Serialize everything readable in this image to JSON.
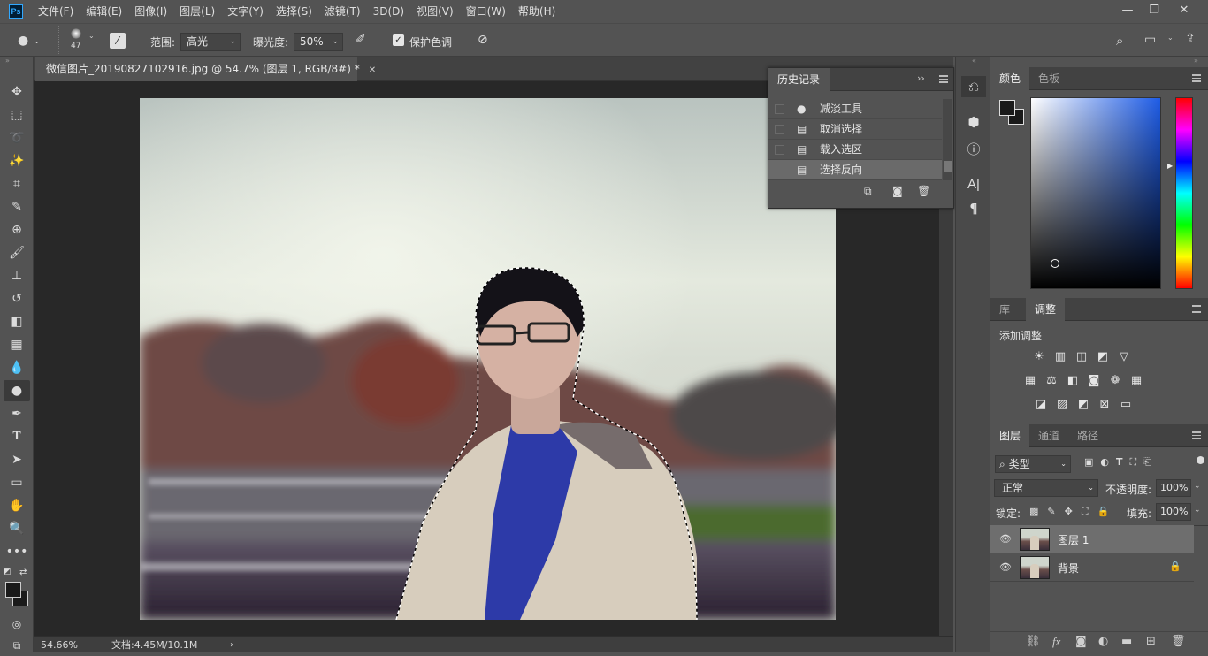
{
  "app": {
    "logo": "Ps"
  },
  "menubar": {
    "items": [
      "文件(F)",
      "编辑(E)",
      "图像(I)",
      "图层(L)",
      "文字(Y)",
      "选择(S)",
      "滤镜(T)",
      "3D(D)",
      "视图(V)",
      "窗口(W)",
      "帮助(H)"
    ]
  },
  "options": {
    "brush_size": "47",
    "range_label": "范围:",
    "range_value": "高光",
    "exposure_label": "曝光度:",
    "exposure_value": "50%",
    "protect_tones_label": "保护色调",
    "protect_tones_checked": true
  },
  "document": {
    "tab_title": "微信图片_20190827102916.jpg @ 54.7% (图层 1, RGB/8#) *",
    "zoom": "54.66%",
    "doc_info": "文档:4.45M/10.1M"
  },
  "history": {
    "title": "历史记录",
    "items": [
      {
        "label": "减淡工具",
        "icon": "dodge-icon"
      },
      {
        "label": "取消选择",
        "icon": "document-icon"
      },
      {
        "label": "载入选区",
        "icon": "document-icon"
      },
      {
        "label": "选择反向",
        "icon": "document-icon"
      }
    ],
    "selected_index": 3
  },
  "color_panel": {
    "tabs": [
      "颜色",
      "色板"
    ],
    "foreground": "#1a1a1a",
    "background": "#1a1a1a",
    "hue_color": "#1e5ce6"
  },
  "adjust_panel": {
    "tabs": [
      "库",
      "调整"
    ],
    "title": "添加调整"
  },
  "layers_panel": {
    "tabs": [
      "图层",
      "通道",
      "路径"
    ],
    "filter_label": "类型",
    "blend_mode": "正常",
    "opacity_label": "不透明度:",
    "opacity_value": "100%",
    "lock_label": "锁定:",
    "fill_label": "填充:",
    "fill_value": "100%",
    "layers": [
      {
        "name": "图层 1",
        "selected": true,
        "locked": false
      },
      {
        "name": "背景",
        "selected": false,
        "locked": true
      }
    ]
  }
}
